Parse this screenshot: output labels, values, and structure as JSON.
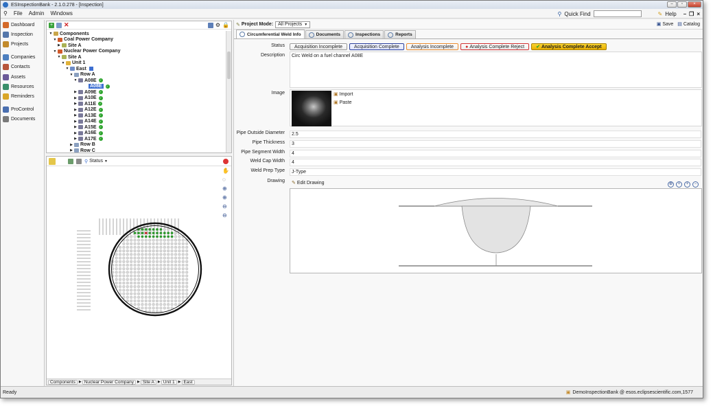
{
  "window": {
    "title": "ESInspectionBank - 2.1.0.278 - [Inspection]",
    "buttons": [
      "–",
      "▫",
      "×"
    ]
  },
  "menu": {
    "items": [
      "File",
      "Admin",
      "Windows"
    ],
    "quick_find": "Quick Find",
    "help": "Help",
    "mdi_buttons": [
      "–",
      "❐",
      "×"
    ]
  },
  "nav": {
    "items": [
      {
        "label": "Dashboard",
        "color": "#d46a2a"
      },
      {
        "label": "Inspection",
        "color": "#5577aa"
      },
      {
        "label": "Projects",
        "color": "#c28a2c"
      },
      {
        "label": "Companies",
        "color": "#4d7fbf"
      },
      {
        "label": "Contacts",
        "color": "#b8553a"
      },
      {
        "label": "Assets",
        "color": "#6b5a99"
      },
      {
        "label": "Resources",
        "color": "#3a8f6a"
      },
      {
        "label": "Reminders",
        "color": "#d9a628"
      },
      {
        "label": "ProControl",
        "color": "#4a6fb0"
      },
      {
        "label": "Documents",
        "color": "#7a7a7a"
      }
    ]
  },
  "tree": {
    "nodes": [
      {
        "label": "Components",
        "level": 0,
        "expander": "▼",
        "bold": true,
        "icon": "#c9a64a"
      },
      {
        "label": "Coal Power Company",
        "level": 1,
        "expander": "▼",
        "bold": true,
        "icon": "#d05a2a"
      },
      {
        "label": "Site A",
        "level": 2,
        "expander": "▶",
        "bold": true,
        "icon": "#aab255"
      },
      {
        "label": "Nuclear Power Company",
        "level": 1,
        "expander": "▼",
        "bold": true,
        "icon": "#d05a2a"
      },
      {
        "label": "Site A",
        "level": 2,
        "expander": "▼",
        "bold": true,
        "icon": "#aab255"
      },
      {
        "label": "Unit 1",
        "level": 3,
        "expander": "▼",
        "bold": true,
        "icon": "#e0b23a"
      },
      {
        "label": "East",
        "level": 4,
        "expander": "▼",
        "bold": true,
        "icon": "#6d8cc7"
      },
      {
        "label": "Row A",
        "level": 5,
        "expander": "▼",
        "bold": true,
        "icon": "#8aa0c0"
      },
      {
        "label": "A08E",
        "level": 6,
        "expander": "▼",
        "bold": true,
        "icon": "#7a7a9a",
        "check": true
      },
      {
        "label": "A08E",
        "level": 7,
        "expander": "",
        "bold": true,
        "icon": "#ffffff",
        "check": true,
        "selected": true
      },
      {
        "label": "A09E",
        "level": 6,
        "expander": "▶",
        "bold": true,
        "icon": "#7a7a9a",
        "check": true
      },
      {
        "label": "A10E",
        "level": 6,
        "expander": "▶",
        "bold": true,
        "icon": "#7a7a9a",
        "check": true
      },
      {
        "label": "A11E",
        "level": 6,
        "expander": "▶",
        "bold": true,
        "icon": "#7a7a9a",
        "check": true
      },
      {
        "label": "A12E",
        "level": 6,
        "expander": "▶",
        "bold": true,
        "icon": "#7a7a9a",
        "check": true
      },
      {
        "label": "A13E",
        "level": 6,
        "expander": "▶",
        "bold": true,
        "icon": "#7a7a9a",
        "check": true
      },
      {
        "label": "A14E",
        "level": 6,
        "expander": "▶",
        "bold": true,
        "icon": "#7a7a9a",
        "check": true
      },
      {
        "label": "A15E",
        "level": 6,
        "expander": "▶",
        "bold": true,
        "icon": "#7a7a9a",
        "check": true
      },
      {
        "label": "A16E",
        "level": 6,
        "expander": "▶",
        "bold": true,
        "icon": "#7a7a9a",
        "check": true
      },
      {
        "label": "A17E",
        "level": 6,
        "expander": "▶",
        "bold": true,
        "icon": "#7a7a9a",
        "check": true
      },
      {
        "label": "Row B",
        "level": 5,
        "expander": "▶",
        "bold": true,
        "icon": "#8aa0c0"
      },
      {
        "label": "Row C",
        "level": 5,
        "expander": "▶",
        "bold": true,
        "icon": "#8aa0c0"
      }
    ]
  },
  "map_toolbar": {
    "status_label": "Status"
  },
  "breadcrumb": [
    "Components",
    "Nuclear Power Company",
    "Site A",
    "Unit 1",
    "East"
  ],
  "project": {
    "label": "Project Mode:",
    "value": "All Projects",
    "save": "Save",
    "catalog": "Catalog"
  },
  "tabs": [
    "Circumferential Weld Info",
    "Documents",
    "Inspections",
    "Reports"
  ],
  "form": {
    "status_label": "Status",
    "status_buttons": [
      {
        "label": "Acquisition Incomplete",
        "style": "sb-plain"
      },
      {
        "label": "Acquisition Complete",
        "style": "sb-blue"
      },
      {
        "label": "Analysis Incomplete",
        "style": "sb-orange"
      },
      {
        "label": "Analysis Complete Reject",
        "style": "sb-red"
      },
      {
        "label": "Analysis Complete Accept",
        "style": "sb-yellow"
      }
    ],
    "description_label": "Description",
    "description": "Circ Weld on a fuel channel A08E",
    "image_label": "Image",
    "import": "Import",
    "paste": "Paste",
    "fields": [
      {
        "label": "Pipe Outside Diameter",
        "value": "2.5"
      },
      {
        "label": "Pipe Thickness",
        "value": "3"
      },
      {
        "label": "Pipe Segment Width",
        "value": "4"
      },
      {
        "label": "Weld Cap Width",
        "value": "4"
      },
      {
        "label": "Weld Prep Type",
        "value": "J-Type"
      }
    ],
    "drawing_label": "Drawing",
    "edit_drawing": "Edit Drawing"
  },
  "statusbar": {
    "left": "Ready",
    "right": "DemoInspectionBank @ esos.eclipsescientific.com,1577"
  }
}
